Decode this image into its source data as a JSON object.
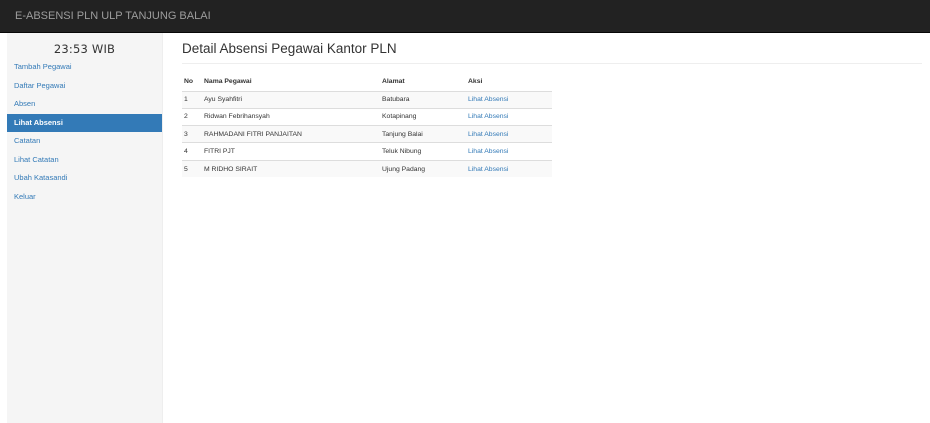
{
  "navbar": {
    "brand": "E-ABSENSI PLN ULP TANJUNG BALAI"
  },
  "sidebar": {
    "clock": "23:53 WIB",
    "items": [
      {
        "label": "Tambah Pegawai",
        "active": false
      },
      {
        "label": "Daftar Pegawai",
        "active": false
      },
      {
        "label": "Absen",
        "active": false
      },
      {
        "label": "Lihat Absensi",
        "active": true
      },
      {
        "label": "Catatan",
        "active": false
      },
      {
        "label": "Lihat Catatan",
        "active": false
      },
      {
        "label": "Ubah Katasandi",
        "active": false
      },
      {
        "label": "Keluar",
        "active": false
      }
    ]
  },
  "main": {
    "title": "Detail Absensi Pegawai Kantor PLN",
    "table": {
      "headers": [
        "No",
        "Nama Pegawai",
        "Alamat",
        "Aksi"
      ],
      "rows": [
        {
          "no": "1",
          "nama": "Ayu Syahfitri",
          "alamat": "Batubara",
          "aksi": "Lihat Absensi"
        },
        {
          "no": "2",
          "nama": "Ridwan Febrihansyah",
          "alamat": "Kotapinang",
          "aksi": "Lihat Absensi"
        },
        {
          "no": "3",
          "nama": "RAHMADANI FITRI PANJAITAN",
          "alamat": "Tanjung Balai",
          "aksi": "Lihat Absensi"
        },
        {
          "no": "4",
          "nama": "FITRI PJT",
          "alamat": "Teluk Nibung",
          "aksi": "Lihat Absensi"
        },
        {
          "no": "5",
          "nama": "M RIDHO SIRAIT",
          "alamat": "Ujung Padang",
          "aksi": "Lihat Absensi"
        }
      ]
    }
  },
  "colors": {
    "navbar_bg": "#222222",
    "navbar_text": "#9d9d9d",
    "link": "#337ab7",
    "active_bg": "#337ab7",
    "sidebar_bg": "#f5f5f5"
  }
}
